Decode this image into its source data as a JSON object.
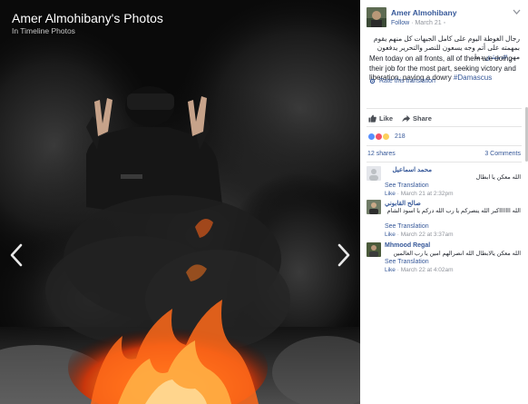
{
  "album": {
    "title": "Amer Almohibany's Photos",
    "subtitle": "In Timeline Photos"
  },
  "post": {
    "author": "Amer Almohibany",
    "follow": "Follow",
    "date": "March 21",
    "arabic_text": "رجال الغوطة اليوم على كامل الجبهات كل منهم يقوم بمهمته على أتم وجه يسعون للنصر والتحرير يدفعون مهر",
    "arabic_tag": "#دمشق",
    "arabic_tail": "دما",
    "english_text": "Men today on all fronts, all of them are doing their job for the most part, seeking victory and liberation, paying a dowry",
    "english_tag": "#Damascus",
    "rate_translation": "Rate this translation"
  },
  "actions": {
    "like": "Like",
    "share": "Share"
  },
  "stats": {
    "reaction_count": "218",
    "shares": "12 shares",
    "comments": "3 Comments"
  },
  "comments": [
    {
      "name": "محمد اسماعيل",
      "text": "الله معكن يا ابطال",
      "see_translation": "See Translation",
      "like": "Like",
      "date": "March 21 at 2:32pm"
    },
    {
      "name": "صالح القابوني",
      "text": "الله اااااااكبر الله ينصركم يا رب الله دركم يا اسود الشام",
      "see_translation": "See Translation",
      "like": "Like",
      "date": "March 22 at 3:37am"
    },
    {
      "name": "Mhmood Regal",
      "text": "الله معكن يالابطال الله انصرالهم امين يا رب العالمين",
      "see_translation": "See Translation",
      "like": "Like",
      "date": "March 22 at 4:02am"
    }
  ],
  "colors": {
    "link": "#365899",
    "muted": "#90949c",
    "fire": "#ff6a1a",
    "like_reaction": "#5890ff",
    "love_reaction": "#f25268",
    "wow_reaction": "#fcd05b"
  },
  "icons": {
    "prev": "chevron-left-icon",
    "next": "chevron-right-icon",
    "like": "thumbs-up-icon",
    "share": "share-arrow-icon",
    "rate": "gear-icon",
    "menu": "chevron-down-icon"
  }
}
